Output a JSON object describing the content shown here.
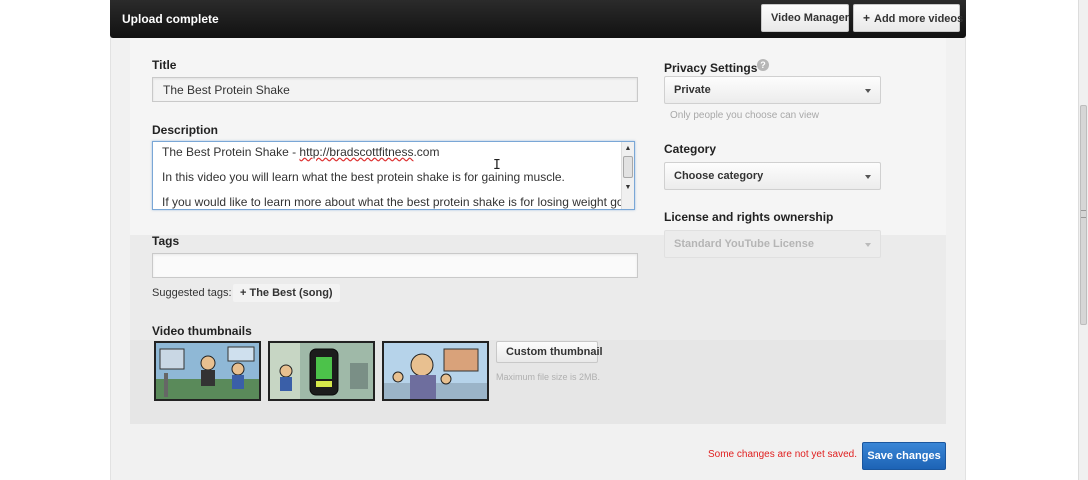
{
  "header": {
    "status": "Upload complete",
    "video_manager_label": "Video Manager",
    "add_more_label": "Add more videos",
    "add_more_icon": "plus-icon"
  },
  "basic_info": {
    "title_label": "Title",
    "title_value": "The Best Protein Shake",
    "description_label": "Description",
    "description_lines": [
      "The Best Protein Shake - ",
      "http://bradscottfitness",
      ".com",
      "In this video you will learn what the best protein shake is for gaining muscle.",
      "If you would like to learn more about what the best protein shake is for losing weight go to"
    ],
    "tags_label": "Tags",
    "tags_value": "",
    "suggested_tags_label": "Suggested tags:",
    "suggested_tags": [
      "+ The Best (song)"
    ]
  },
  "thumbnails": {
    "label": "Video thumbnails",
    "custom_button_label": "Custom thumbnail",
    "max_file_size": "Maximum file size is 2MB."
  },
  "privacy": {
    "label": "Privacy Settings",
    "help_icon": "help-icon",
    "help_glyph": "?",
    "selected": "Private",
    "hint": "Only people you choose can view"
  },
  "category": {
    "label": "Category",
    "selected": "Choose category"
  },
  "license": {
    "label": "License and rights ownership",
    "selected": "Standard YouTube License"
  },
  "footer": {
    "unsaved_message": "Some changes are not yet saved.",
    "save_label": "Save changes"
  },
  "colors": {
    "save_button": "#1d63b5",
    "unsaved_text": "#e02020",
    "header_bar": "#1a1a1a"
  }
}
